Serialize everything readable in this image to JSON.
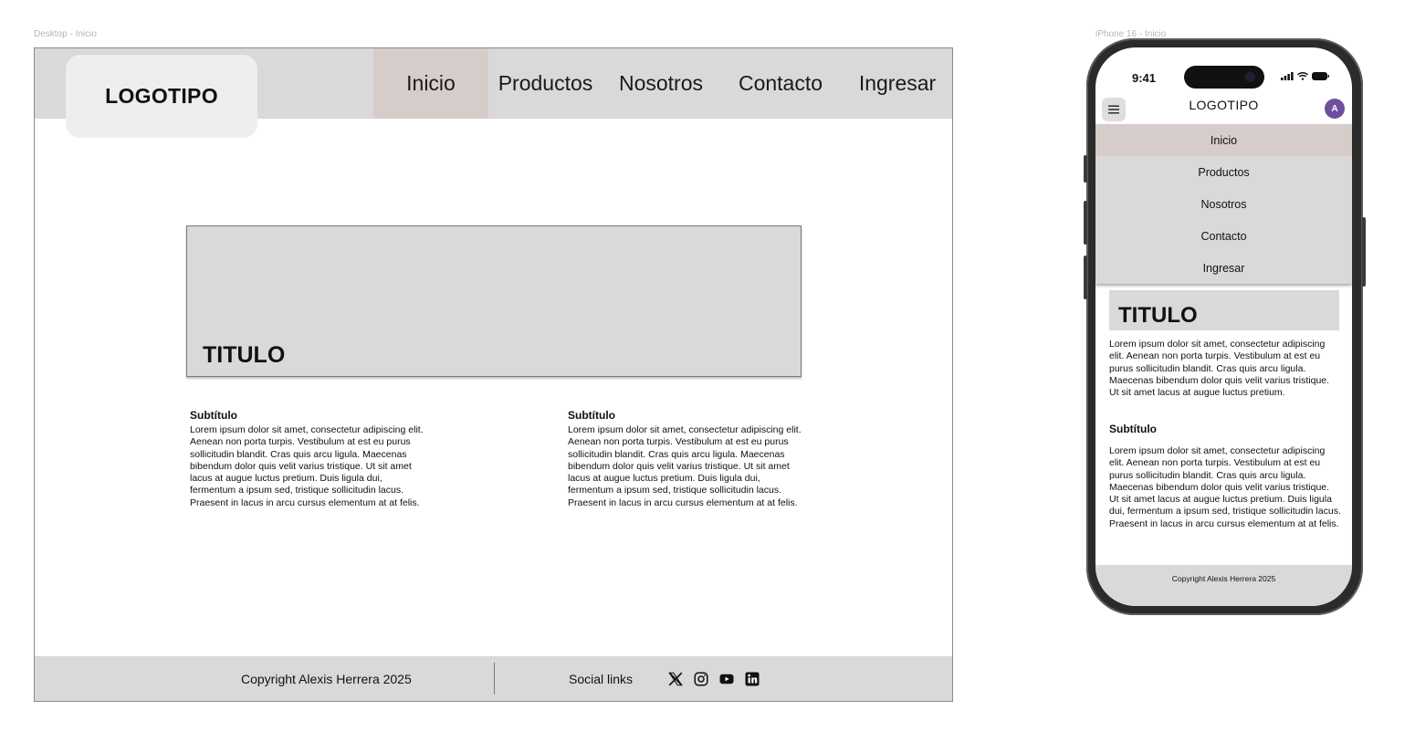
{
  "frames": {
    "desktop_label": "Desktop - Inicio",
    "phone_label": "iPhone 16 - Inicio"
  },
  "desktop": {
    "logo": "LOGOTIPO",
    "nav": [
      {
        "label": "Inicio",
        "active": true
      },
      {
        "label": "Productos",
        "active": false
      },
      {
        "label": "Nosotros",
        "active": false
      },
      {
        "label": "Contacto",
        "active": false
      },
      {
        "label": "Ingresar",
        "active": false
      }
    ],
    "hero_title": "TITULO",
    "columns": [
      {
        "subtitle": "Subtítulo",
        "body": "Lorem ipsum dolor sit amet, consectetur adipiscing elit. Aenean non porta turpis. Vestibulum at est eu purus sollicitudin blandit. Cras quis arcu ligula. Maecenas bibendum dolor quis velit varius tristique. Ut sit amet lacus at augue luctus pretium. Duis ligula dui, fermentum a ipsum sed, tristique sollicitudin lacus. Praesent in lacus in arcu cursus elementum at at felis."
      },
      {
        "subtitle": "Subtítulo",
        "body": "Lorem ipsum dolor sit amet, consectetur adipiscing elit. Aenean non porta turpis. Vestibulum at est eu purus sollicitudin blandit. Cras quis arcu ligula. Maecenas bibendum dolor quis velit varius tristique. Ut sit amet lacus at augue luctus pretium. Duis ligula dui, fermentum a ipsum sed, tristique sollicitudin lacus. Praesent in lacus in arcu cursus elementum at at felis."
      }
    ],
    "footer": {
      "copyright": "Copyright Alexis Herrera 2025",
      "social_label": "Social links",
      "social_icons": [
        "x-icon",
        "instagram-icon",
        "youtube-icon",
        "linkedin-icon"
      ]
    }
  },
  "phone": {
    "status_time": "9:41",
    "logo": "LOGOTIPO",
    "avatar_initial": "A",
    "nav": [
      {
        "label": "Inicio",
        "active": true
      },
      {
        "label": "Productos",
        "active": false
      },
      {
        "label": "Nosotros",
        "active": false
      },
      {
        "label": "Contacto",
        "active": false
      },
      {
        "label": "Ingresar",
        "active": false
      }
    ],
    "hero_title": "TITULO",
    "intro": "Lorem ipsum dolor sit amet, consectetur adipiscing elit. Aenean non porta turpis. Vestibulum at est eu purus sollicitudin blandit. Cras quis arcu ligula. Maecenas bibendum dolor quis velit varius tristique. Ut sit amet lacus at augue luctus pretium.",
    "subtitle": "Subtítulo",
    "body": "Lorem ipsum dolor sit amet, consectetur adipiscing elit. Aenean non porta turpis. Vestibulum at est eu purus sollicitudin blandit. Cras quis arcu ligula. Maecenas bibendum dolor quis velit varius tristique. Ut sit amet lacus at augue luctus pretium. Duis ligula dui, fermentum a ipsum sed, tristique sollicitudin lacus. Praesent in lacus in arcu cursus elementum at at felis.",
    "footer": "Copyright Alexis Herrera 2025"
  },
  "colors": {
    "header_bg": "#d9d9d9",
    "active_nav": "#d6ccca",
    "logo_box": "#eeeeee",
    "avatar": "#6f4e9e"
  }
}
